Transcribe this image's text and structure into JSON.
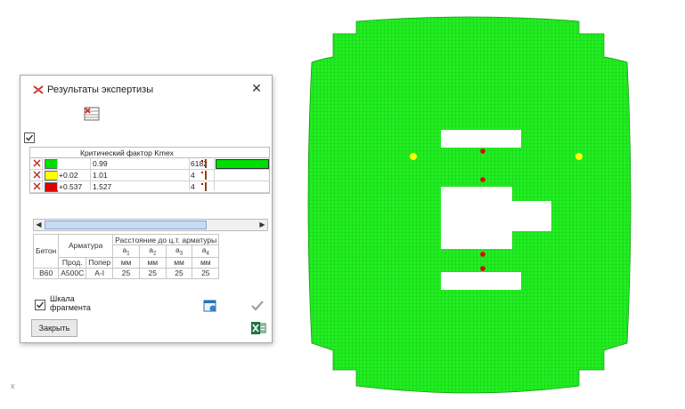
{
  "dialog": {
    "title": "Результаты экспертизы",
    "close_glyph": "✕",
    "main_checkbox_checked": true,
    "grid_header": "Критический фактор Kmex",
    "rows": [
      {
        "color": "#00dd00",
        "from": "",
        "to": "0.99",
        "count": "6182",
        "bar_fraction": 1.0
      },
      {
        "color": "#ffff00",
        "from": "+0.02",
        "to": "1.01",
        "count": "4",
        "bar_fraction": 0.0
      },
      {
        "color": "#dd0000",
        "from": "+0.537",
        "to": "1.527",
        "count": "4",
        "bar_fraction": 0.0
      }
    ],
    "scroll": {
      "left_glyph": "◀",
      "right_glyph": "▶"
    },
    "table": {
      "beton_label": "Бетон",
      "armatura_label": "Арматура",
      "distance_label": "Расстояние до ц.т. арматуры",
      "prod_label": "Прод.",
      "poper_label": "Попер",
      "a_labels": [
        "a",
        "a",
        "a",
        "a"
      ],
      "a_subs": [
        "1",
        "2",
        "3",
        "4"
      ],
      "units": [
        "мм",
        "мм",
        "мм",
        "мм"
      ],
      "row": {
        "beton": "B60",
        "prod": "A500C",
        "poper": "A-I",
        "a": [
          "25",
          "25",
          "25",
          "25"
        ]
      }
    },
    "scale_checkbox_checked": true,
    "scale_label_line1": "Шкала",
    "scale_label_line2": "фрагмента",
    "close_button": "Закрыть",
    "icons": [
      "grid-settings-icon",
      "window-icon",
      "apply-check-icon",
      "export-xls-icon"
    ]
  },
  "canvas_marker": "x",
  "plot": {
    "mesh_color": "#22ee22",
    "line_color": "#11bb11",
    "yellow_points": 2,
    "red_points": 4
  }
}
